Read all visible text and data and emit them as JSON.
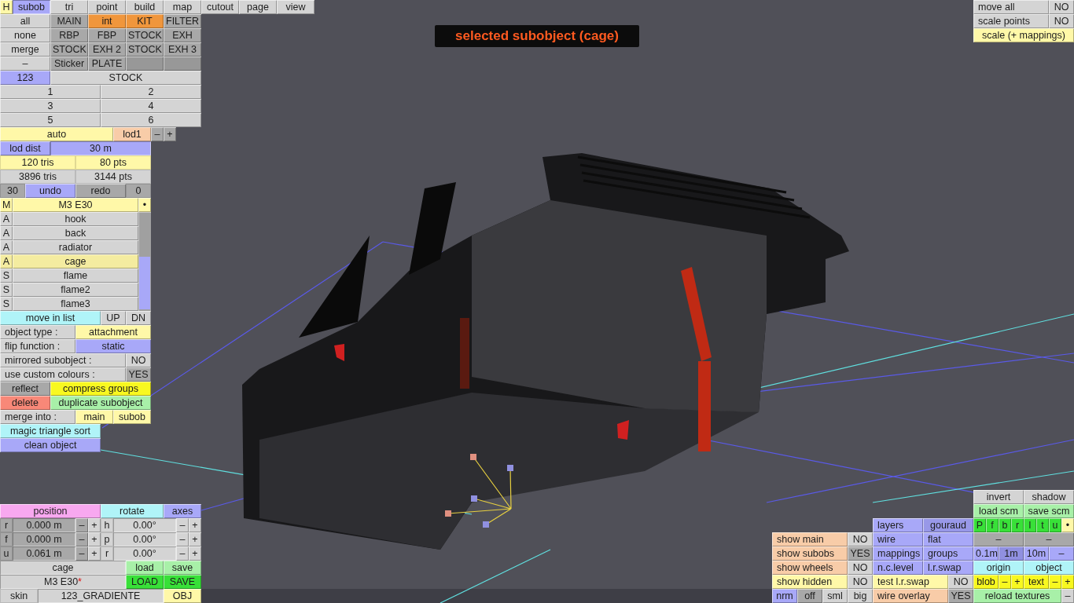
{
  "mode_tabs": [
    {
      "label": "H",
      "color": "#fff8a8",
      "selected": false
    },
    {
      "label": "subob",
      "color": "#a8a8f8",
      "selected": true
    },
    {
      "label": "tri",
      "color": "#d4d4d4",
      "selected": false
    },
    {
      "label": "point",
      "color": "#d4d4d4",
      "selected": false
    },
    {
      "label": "build",
      "color": "#d4d4d4",
      "selected": false
    },
    {
      "label": "map",
      "color": "#d4d4d4",
      "selected": false
    },
    {
      "label": "cutout",
      "color": "#d4d4d4",
      "selected": false
    },
    {
      "label": "page",
      "color": "#d4d4d4",
      "selected": false
    },
    {
      "label": "view",
      "color": "#d4d4d4",
      "selected": false
    }
  ],
  "left_panel_top": [
    [
      {
        "text": "all",
        "kind": "btn",
        "color": "#d4d4d4"
      },
      {
        "text": "MAIN",
        "kind": "btn",
        "color": "#a8a8a8"
      },
      {
        "text": "int",
        "kind": "btn",
        "color": "#f0963c"
      },
      {
        "text": "KIT",
        "kind": "btn",
        "color": "#f0963c"
      },
      {
        "text": "FILTER",
        "kind": "btn",
        "color": "#a8a8a8"
      }
    ],
    [
      {
        "text": "none",
        "kind": "btn",
        "color": "#d4d4d4"
      },
      {
        "text": "RBP",
        "kind": "btn",
        "color": "#a8a8a8"
      },
      {
        "text": "FBP",
        "kind": "btn",
        "color": "#a8a8a8"
      },
      {
        "text": "STOCK",
        "kind": "btn",
        "color": "#a8a8a8"
      },
      {
        "text": "EXH",
        "kind": "btn",
        "color": "#a8a8a8"
      }
    ],
    [
      {
        "text": "merge",
        "kind": "btn",
        "color": "#d4d4d4"
      },
      {
        "text": "STOCK",
        "kind": "btn",
        "color": "#a8a8a8"
      },
      {
        "text": "EXH 2",
        "kind": "btn",
        "color": "#a8a8a8"
      },
      {
        "text": "STOCK",
        "kind": "btn",
        "color": "#a8a8a8"
      },
      {
        "text": "EXH 3",
        "kind": "btn",
        "color": "#a8a8a8"
      }
    ],
    [
      {
        "text": "–",
        "kind": "btn",
        "color": "#d4d4d4"
      },
      {
        "text": "Sticker",
        "kind": "btn",
        "color": "#a8a8a8"
      },
      {
        "text": "PLATE",
        "kind": "btn",
        "color": "#a8a8a8"
      },
      {
        "kind": "btn",
        "color": "#989898"
      },
      {
        "kind": "btn",
        "color": "#989898"
      }
    ],
    [
      {
        "text": "123",
        "kind": "btn",
        "color": "#a8a8f8"
      },
      {
        "text": "STOCK",
        "kind": "btn",
        "color": "#d4d4d4"
      }
    ],
    [
      {
        "text": "1",
        "kind": "btn",
        "color": "#d4d4d4"
      },
      {
        "text": "2",
        "kind": "btn",
        "color": "#d4d4d4"
      }
    ],
    [
      {
        "text": "3",
        "kind": "btn",
        "color": "#d4d4d4"
      },
      {
        "text": "4",
        "kind": "btn",
        "color": "#d4d4d4"
      }
    ],
    [
      {
        "text": "5",
        "kind": "btn",
        "color": "#d4d4d4"
      },
      {
        "text": "6",
        "kind": "btn",
        "color": "#d4d4d4"
      }
    ],
    [
      {
        "text": "auto",
        "kind": "btn",
        "color": "#fff8a8"
      },
      {
        "text": "lod1",
        "kind": "btn",
        "color": "#f8cca8"
      },
      {
        "text": "–",
        "kind": "btn",
        "color": "#a8a8a8"
      },
      {
        "text": "+",
        "kind": "btn",
        "color": "#a8a8a8"
      }
    ],
    [
      {
        "text": "lod dist",
        "kind": "btn",
        "color": "#a8a8f8"
      },
      {
        "text": "30 m",
        "kind": "value",
        "color": "#a8a8f8"
      }
    ],
    [
      {
        "text": "120 tris",
        "kind": "stat",
        "color": "#fff8a8"
      },
      {
        "text": "80 pts",
        "kind": "stat",
        "color": "#fff8a8"
      }
    ],
    [
      {
        "text": "3896 tris",
        "kind": "stat",
        "color": "#d4d4d4"
      },
      {
        "text": "3144 pts",
        "kind": "stat",
        "color": "#d4d4d4"
      }
    ],
    [
      {
        "text": "30",
        "kind": "stat",
        "color": "#a8a8a8"
      },
      {
        "text": "undo",
        "kind": "btn",
        "color": "#a8a8f8"
      },
      {
        "text": "redo",
        "kind": "btn",
        "color": "#a8a8a8"
      },
      {
        "text": "0",
        "kind": "stat",
        "color": "#a8a8a8"
      }
    ]
  ],
  "object_list": {
    "header": {
      "type": "M",
      "name": "M3 E30",
      "marker": "•"
    },
    "items": [
      {
        "type": "A",
        "name": "hook",
        "selected": false
      },
      {
        "type": "A",
        "name": "back",
        "selected": false
      },
      {
        "type": "A",
        "name": "radiator",
        "selected": false
      },
      {
        "type": "A",
        "name": "cage",
        "selected": true
      },
      {
        "type": "S",
        "name": "flame",
        "selected": false
      },
      {
        "type": "S",
        "name": "flame2",
        "selected": false
      },
      {
        "type": "S",
        "name": "flame3",
        "selected": false
      }
    ]
  },
  "left_panel_bottom": [
    [
      {
        "text": "move in list",
        "kind": "btn",
        "color": "#b0f4f8"
      },
      {
        "text": "UP",
        "kind": "btn",
        "color": "#d4d4d4"
      },
      {
        "text": "DN",
        "kind": "btn",
        "color": "#d4d4d4"
      }
    ],
    [
      {
        "text": "object type :",
        "kind": "label",
        "color": "#d4d4d4"
      },
      {
        "text": "attachment",
        "kind": "btn",
        "color": "#fff8a8"
      }
    ],
    [
      {
        "text": "flip function :",
        "kind": "label",
        "color": "#d4d4d4"
      },
      {
        "text": "static",
        "kind": "btn",
        "color": "#a8a8f8"
      }
    ],
    [
      {
        "text": "mirrored subobject :",
        "kind": "label",
        "color": "#d4d4d4"
      },
      {
        "text": "NO",
        "kind": "btn",
        "color": "#d4d4d4"
      }
    ],
    [
      {
        "text": "use custom colours :",
        "kind": "label",
        "color": "#d4d4d4"
      },
      {
        "text": "YES",
        "kind": "btn",
        "color": "#a8a8a8"
      }
    ],
    [
      {
        "text": "reflect",
        "kind": "btn",
        "color": "#a8a8a8"
      },
      {
        "text": "compress groups",
        "kind": "btn",
        "color": "#f8f820"
      }
    ],
    [
      {
        "text": "delete",
        "kind": "btn",
        "color": "#f88878"
      },
      {
        "text": "duplicate subobject",
        "kind": "btn",
        "color": "#a8f0a8"
      }
    ],
    [
      {
        "text": "merge into :",
        "kind": "label",
        "color": "#d4d4d4"
      },
      {
        "text": "main",
        "kind": "btn",
        "color": "#fff8a8"
      },
      {
        "text": "subob",
        "kind": "btn",
        "color": "#fff8a8"
      }
    ],
    [
      {
        "text": "magic triangle sort",
        "kind": "btn",
        "color": "#b0f4f8"
      }
    ],
    [
      {
        "text": "clean object",
        "kind": "btn",
        "color": "#a8a8f8"
      }
    ]
  ],
  "viewport_title": "selected subobject (cage)",
  "top_right_panel": [
    [
      {
        "text": "move all",
        "kind": "label",
        "color": "#d4d4d4"
      },
      {
        "text": "NO",
        "kind": "btn",
        "color": "#d4d4d4"
      }
    ],
    [
      {
        "text": "scale points",
        "kind": "label",
        "color": "#d4d4d4"
      },
      {
        "text": "NO",
        "kind": "btn",
        "color": "#d4d4d4"
      }
    ],
    [
      {
        "text": "scale (+ mappings)",
        "kind": "btn",
        "color": "#fff8a8"
      }
    ]
  ],
  "transform_panel": [
    [
      {
        "text": "position",
        "kind": "btn",
        "color": "#f8a8f0"
      },
      {
        "text": "rotate",
        "kind": "btn",
        "color": "#b0f4f8"
      },
      {
        "text": "axes",
        "kind": "btn",
        "color": "#a8a8f8"
      }
    ],
    [
      {
        "text": "r",
        "kind": "stat",
        "color": "#a8a8a8"
      },
      {
        "text": "0.000 m",
        "kind": "value",
        "color": "#a8a8a8"
      },
      {
        "text": "–",
        "kind": "btn",
        "color": "#a8a8a8"
      },
      {
        "text": "+",
        "kind": "btn",
        "color": "#d4d4d4"
      },
      {
        "text": "h",
        "kind": "stat",
        "color": "#d4d4d4"
      },
      {
        "text": "0.00°",
        "kind": "value",
        "color": "#d4d4d4"
      },
      {
        "text": "–",
        "kind": "btn",
        "color": "#d4d4d4"
      },
      {
        "text": "+",
        "kind": "btn",
        "color": "#d4d4d4"
      }
    ],
    [
      {
        "text": "f",
        "kind": "stat",
        "color": "#a8a8a8"
      },
      {
        "text": "0.000 m",
        "kind": "value",
        "color": "#a8a8a8"
      },
      {
        "text": "–",
        "kind": "btn",
        "color": "#a8a8a8"
      },
      {
        "text": "+",
        "kind": "btn",
        "color": "#d4d4d4"
      },
      {
        "text": "p",
        "kind": "stat",
        "color": "#d4d4d4"
      },
      {
        "text": "0.00°",
        "kind": "value",
        "color": "#d4d4d4"
      },
      {
        "text": "–",
        "kind": "btn",
        "color": "#d4d4d4"
      },
      {
        "text": "+",
        "kind": "btn",
        "color": "#d4d4d4"
      }
    ],
    [
      {
        "text": "u",
        "kind": "stat",
        "color": "#a8a8a8"
      },
      {
        "text": "0.061 m",
        "kind": "value",
        "color": "#a8a8a8"
      },
      {
        "text": "–",
        "kind": "btn",
        "color": "#a8a8a8"
      },
      {
        "text": "+",
        "kind": "btn",
        "color": "#d4d4d4"
      },
      {
        "text": "r",
        "kind": "stat",
        "color": "#d4d4d4"
      },
      {
        "text": "0.00°",
        "kind": "value",
        "color": "#d4d4d4"
      },
      {
        "text": "–",
        "kind": "btn",
        "color": "#d4d4d4"
      },
      {
        "text": "+",
        "kind": "btn",
        "color": "#d4d4d4"
      }
    ],
    [
      {
        "text": "cage",
        "kind": "value",
        "color": "#d4d4d4"
      },
      {
        "text": "load",
        "kind": "btn",
        "color": "#a8f0a8"
      },
      {
        "text": "save",
        "kind": "btn",
        "color": "#a8f0a8"
      }
    ],
    [
      {
        "text": "M3 E30",
        "suffix": "*",
        "kind": "value",
        "color": "#d4d4d4"
      },
      {
        "text": "LOAD",
        "kind": "btn",
        "color": "#38e038"
      },
      {
        "text": "SAVE",
        "kind": "btn",
        "color": "#38e038"
      }
    ],
    [
      {
        "text": "skin",
        "kind": "stat",
        "color": "#d4d4d4"
      },
      {
        "text": "123_GRADIENTE",
        "kind": "value",
        "color": "#d4d4d4"
      },
      {
        "text": "OBJ",
        "kind": "btn",
        "color": "#fff8a8"
      }
    ]
  ],
  "display_panel": [
    [
      {
        "text": "invert",
        "kind": "btn",
        "color": "#d4d4d4"
      },
      {
        "text": "shadow",
        "kind": "btn",
        "color": "#d4d4d4"
      }
    ],
    [
      {
        "text": "load scm",
        "kind": "btn",
        "color": "#a8f0a8"
      },
      {
        "text": "save scm",
        "kind": "btn",
        "color": "#a8f0a8"
      }
    ],
    [
      {
        "text": "layers",
        "kind": "label",
        "color": "#a8a8f8"
      },
      {
        "text": "gouraud",
        "kind": "btn",
        "color": "#9898e8"
      },
      {
        "text": "P",
        "kind": "btn",
        "color": "#38e038"
      },
      {
        "text": "f",
        "kind": "btn",
        "color": "#38e038"
      },
      {
        "text": "b",
        "kind": "btn",
        "color": "#38e038"
      },
      {
        "text": "r",
        "kind": "btn",
        "color": "#38e038"
      },
      {
        "text": "l",
        "kind": "btn",
        "color": "#38e038"
      },
      {
        "text": "t",
        "kind": "btn",
        "color": "#38e038"
      },
      {
        "text": "u",
        "kind": "btn",
        "color": "#38e038"
      },
      {
        "text": "•",
        "kind": "btn",
        "color": "#fff8a8"
      }
    ],
    [
      {
        "text": "show main",
        "kind": "label",
        "color": "#f8cca8"
      },
      {
        "text": "NO",
        "kind": "btn",
        "color": "#d4d4d4"
      },
      {
        "text": "wire",
        "kind": "label",
        "color": "#a8a8f8"
      },
      {
        "text": "flat",
        "kind": "label",
        "color": "#a8a8f8"
      },
      {
        "text": "–",
        "kind": "btn",
        "color": "#a8a8a8"
      },
      {
        "text": "–",
        "kind": "btn",
        "color": "#a8a8a8"
      }
    ],
    [
      {
        "text": "show subobs",
        "kind": "label",
        "color": "#f8cca8"
      },
      {
        "text": "YES",
        "kind": "btn",
        "color": "#a8a8a8"
      },
      {
        "text": "mappings",
        "kind": "label",
        "color": "#a8a8f8"
      },
      {
        "text": "groups",
        "kind": "label",
        "color": "#a8a8f8"
      },
      {
        "text": "0.1m",
        "kind": "btn",
        "color": "#a8a8f8"
      },
      {
        "text": "1m",
        "kind": "btn",
        "color": "#9090e0"
      },
      {
        "text": "10m",
        "kind": "btn",
        "color": "#a8a8f8"
      },
      {
        "text": "–",
        "kind": "btn",
        "color": "#a8a8f8"
      }
    ],
    [
      {
        "text": "show wheels",
        "kind": "label",
        "color": "#f8cca8"
      },
      {
        "text": "NO",
        "kind": "btn",
        "color": "#d4d4d4"
      },
      {
        "text": "n.c.level",
        "kind": "label",
        "color": "#a8a8f8"
      },
      {
        "text": "l.r.swap",
        "kind": "label",
        "color": "#a8a8f8"
      },
      {
        "text": "origin",
        "kind": "btn",
        "color": "#b0f4f8"
      },
      {
        "text": "object",
        "kind": "btn",
        "color": "#b0f4f8"
      }
    ],
    [
      {
        "text": "show hidden",
        "kind": "label",
        "color": "#fff8a8"
      },
      {
        "text": "NO",
        "kind": "btn",
        "color": "#d4d4d4"
      },
      {
        "text": "test l.r.swap",
        "kind": "label",
        "color": "#fff8a8"
      },
      {
        "text": "NO",
        "kind": "btn",
        "color": "#d4d4d4"
      },
      {
        "text": "blob",
        "kind": "btn",
        "color": "#f8f820"
      },
      {
        "text": "–",
        "kind": "btn",
        "color": "#f8f820"
      },
      {
        "text": "+",
        "kind": "btn",
        "color": "#f8f820"
      },
      {
        "text": "text",
        "kind": "btn",
        "color": "#f8f820"
      },
      {
        "text": "–",
        "kind": "btn",
        "color": "#f8f820"
      },
      {
        "text": "+",
        "kind": "btn",
        "color": "#f8f820"
      }
    ],
    [
      {
        "text": "nrm",
        "kind": "btn",
        "color": "#a8a8f8"
      },
      {
        "text": "off",
        "kind": "btn",
        "color": "#a8a8a8"
      },
      {
        "text": "sml",
        "kind": "btn",
        "color": "#d4d4d4"
      },
      {
        "text": "big",
        "kind": "btn",
        "color": "#d4d4d4"
      },
      {
        "text": "wire overlay",
        "kind": "label",
        "color": "#f8cca8"
      },
      {
        "text": "YES",
        "kind": "btn",
        "color": "#a8a8a8"
      },
      {
        "text": "reload textures",
        "kind": "btn",
        "color": "#a8f0a8"
      },
      {
        "text": "–",
        "kind": "btn",
        "color": "#d4d4d4"
      }
    ]
  ]
}
